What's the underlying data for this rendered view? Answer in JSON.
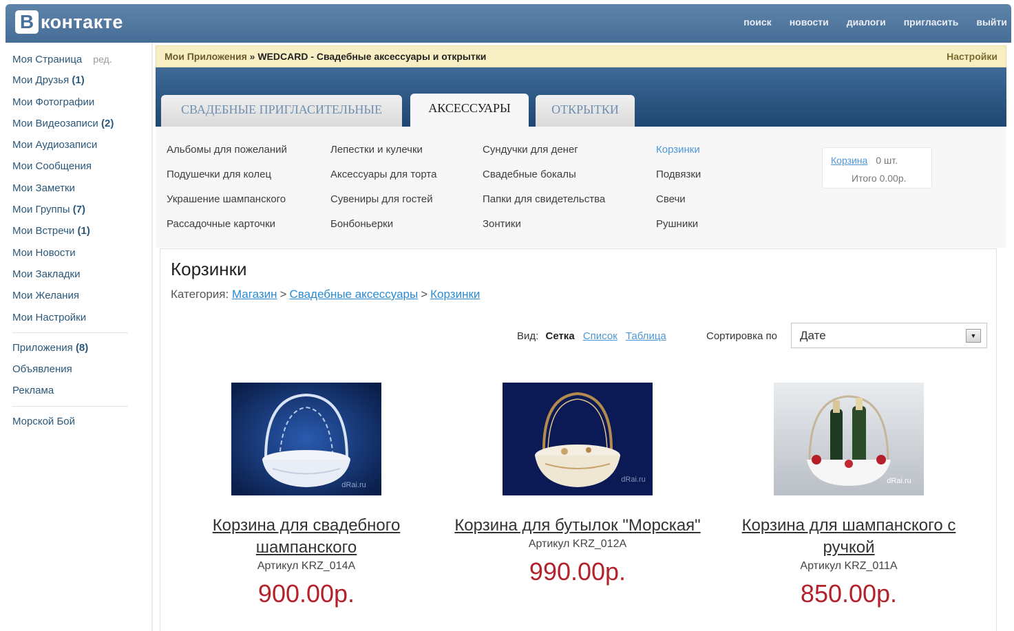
{
  "header": {
    "logo_letter": "B",
    "logo_text": "контакте",
    "nav": [
      "поиск",
      "новости",
      "диалоги",
      "пригласить",
      "выйти"
    ]
  },
  "sidebar": {
    "edit_label": "ред.",
    "group1": [
      {
        "label": "Моя Страница",
        "count": ""
      },
      {
        "label": "Мои Друзья",
        "count": "(1)"
      },
      {
        "label": "Мои Фотографии",
        "count": ""
      },
      {
        "label": "Мои Видеозаписи",
        "count": "(2)"
      },
      {
        "label": "Мои Аудиозаписи",
        "count": ""
      },
      {
        "label": "Мои Сообщения",
        "count": ""
      },
      {
        "label": "Мои Заметки",
        "count": ""
      },
      {
        "label": "Мои Группы",
        "count": "(7)"
      },
      {
        "label": "Мои Встречи",
        "count": "(1)"
      },
      {
        "label": "Мои Новости",
        "count": ""
      },
      {
        "label": "Мои Закладки",
        "count": ""
      },
      {
        "label": "Мои Желания",
        "count": ""
      },
      {
        "label": "Мои Настройки",
        "count": ""
      }
    ],
    "group2": [
      {
        "label": "Приложения",
        "count": "(8)"
      },
      {
        "label": "Объявления",
        "count": ""
      },
      {
        "label": "Реклама",
        "count": ""
      }
    ],
    "group3": [
      {
        "label": "Морской Бой",
        "count": ""
      }
    ]
  },
  "breadcrumb": {
    "root": "Мои Приложения",
    "separator": "»",
    "current": "WEDCARD - Свадебные аксессуары и открытки",
    "settings": "Настройки"
  },
  "tabs": {
    "tab1": "СВАДЕБНЫЕ ПРИГЛАСИТЕЛЬНЫЕ",
    "tab2": "АКСЕССУАРЫ",
    "tab3": "ОТКРЫТКИ"
  },
  "categories": {
    "col1": [
      "Альбомы для пожеланий",
      "Подушечки для колец",
      "Украшение шампанского",
      "Рассадочные карточки"
    ],
    "col2": [
      "Лепестки и кулечки",
      "Аксессуары для торта",
      "Сувениры для гостей",
      "Бонбоньерки"
    ],
    "col3": [
      "Сундучки для денег",
      "Свадебные бокалы",
      "Папки для свидетельства",
      "Зонтики"
    ],
    "col4": [
      "Корзинки",
      "Подвязки",
      "Свечи",
      "Рушники"
    ]
  },
  "cart": {
    "link": "Корзина",
    "count": "0 шт.",
    "total_label": "Итого",
    "total": "0.00р."
  },
  "page": {
    "title": "Корзинки",
    "category_label": "Категория:",
    "crumbs": [
      "Магазин",
      "Свадебные аксессуары",
      "Корзинки"
    ],
    "crumb_sep": ">",
    "view_label": "Вид:",
    "view_active": "Сетка",
    "view_list": "Список",
    "view_table": "Таблица",
    "sort_label": "Сортировка по",
    "sort_value": "Дате"
  },
  "products": [
    {
      "name": "Корзина для свадебного шампанского",
      "sku": "Артикул KRZ_014A",
      "price": "900.00р.",
      "watermark": "dRai.ru"
    },
    {
      "name": "Корзина для бутылок \"Морская\"",
      "sku": "Артикул KRZ_012A",
      "price": "990.00р.",
      "watermark": "dRai.ru"
    },
    {
      "name": "Корзина для шампанского с ручкой",
      "sku": "Артикул KRZ_011A",
      "price": "850.00р.",
      "watermark": "dRai.ru"
    }
  ],
  "colors": {
    "header": "#4b739c",
    "link": "#2b587a",
    "price": "#b3222a"
  }
}
